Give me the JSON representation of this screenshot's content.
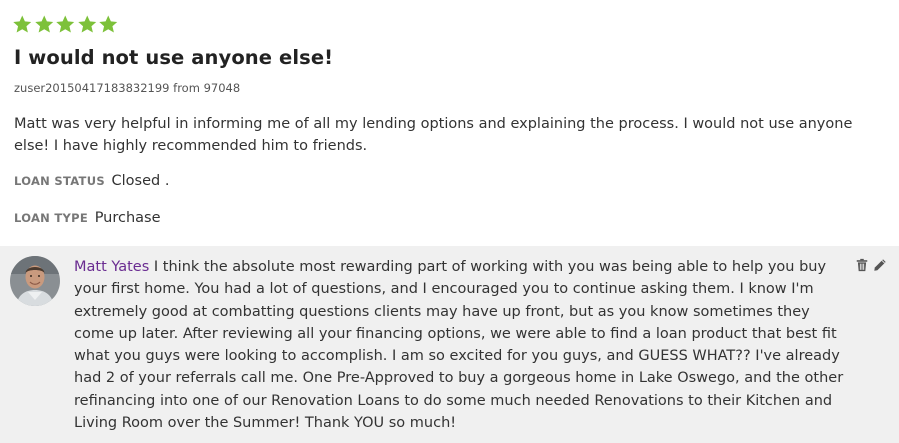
{
  "review": {
    "rating": 5,
    "rating_max": 5,
    "star_color": "#7dc13a",
    "title": "I would not use anyone else!",
    "author_line": "zuser20150417183832199 from 97048",
    "body": "Matt was very helpful in informing me of all my lending options and explaining the process. I would not use anyone else! I have highly recommended him to friends.",
    "loan_status": {
      "label": "LOAN STATUS",
      "value": "Closed ."
    },
    "loan_type": {
      "label": "LOAN TYPE",
      "value": "Purchase"
    }
  },
  "reply": {
    "name": "Matt Yates",
    "name_color": "#6a2c91",
    "text": "I think the absolute most rewarding part of working with you was being able to help you buy your first home. You had a lot of questions, and I encouraged you to continue asking them. I know I'm extremely good at combatting questions clients may have up front, but as you know sometimes they come up later. After reviewing all your financing options, we were able to find a loan product that best fit what you guys were looking to accomplish. I am so excited for you guys, and GUESS WHAT?? I've already had 2 of your referrals call me. One Pre-Approved to buy a gorgeous home in Lake Oswego, and the other refinancing into one of our Renovation Loans to do some much needed Renovations to their Kitchen and Living Room over the Summer! Thank YOU so much!",
    "actions": [
      "trash-icon",
      "pencil-icon"
    ],
    "background": "#f0f0f0"
  }
}
